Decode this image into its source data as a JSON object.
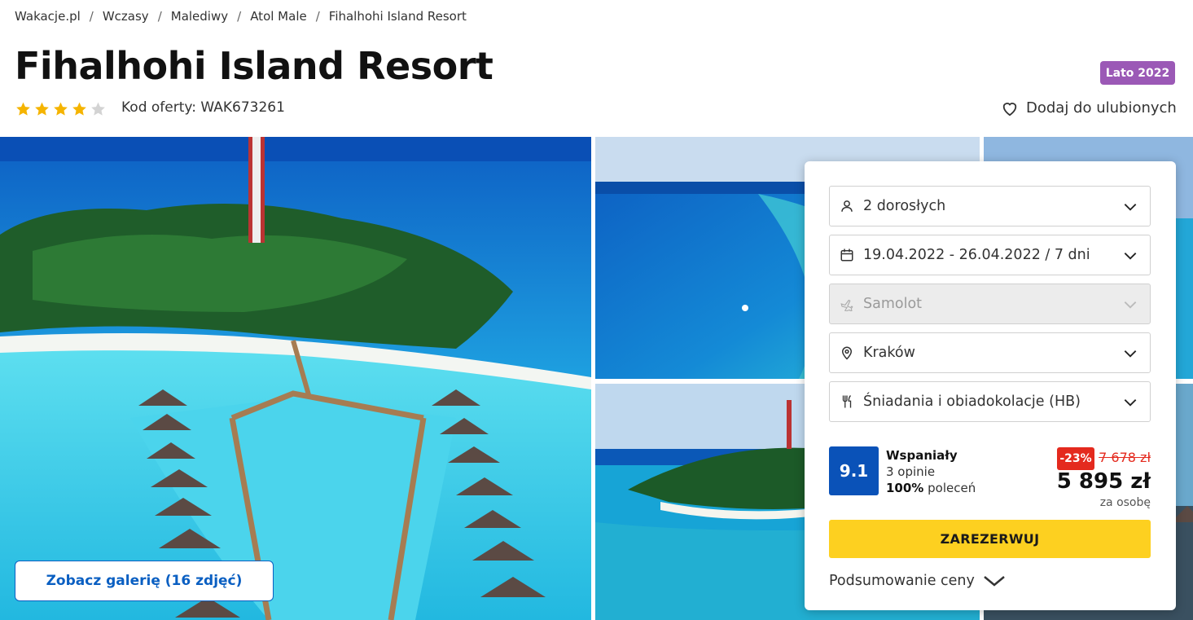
{
  "breadcrumb": [
    "Wakacje.pl",
    "Wczasy",
    "Malediwy",
    "Atol Male",
    "Fihalhohi Island Resort"
  ],
  "hotel": {
    "name": "Fihalhohi Island Resort",
    "stars": 4,
    "max_stars": 5,
    "offer_code": "Kod oferty: WAK673261",
    "season_badge": "Lato 2022",
    "favorite_label": "Dodaj do ulubionych"
  },
  "gallery": {
    "button_label": "Zobacz galerię (16 zdjęć)"
  },
  "booking": {
    "travelers": "2 dorosłych",
    "dates": "19.04.2022 - 26.04.2022 / 7 dni",
    "transport": "Samolot",
    "departure": "Kraków",
    "board": "Śniadania i obiadokolacje (HB)",
    "rating": {
      "score": "9.1",
      "label": "Wspaniały",
      "reviews": "3 opinie",
      "recommend_pct": "100%",
      "recommend_text": "poleceń"
    },
    "discount": "-23%",
    "old_price": "7 678 zł",
    "price": "5 895 zł",
    "per_person": "za osobę",
    "book_label": "ZAREZERWUJ",
    "summary_label": "Podsumowanie ceny"
  },
  "colors": {
    "brand_blue": "#0a5fc2",
    "rating_blue": "#0a52b8",
    "cta_yellow": "#fdd020",
    "badge_purple": "#9b59b6",
    "discount_red": "#e42a1e",
    "star_gold": "#f5b400"
  },
  "icons": [
    "user-icon",
    "calendar-icon",
    "plane-icon",
    "location-pin-icon",
    "cutlery-icon",
    "chevron-down-icon",
    "heart-icon",
    "star-icon"
  ]
}
